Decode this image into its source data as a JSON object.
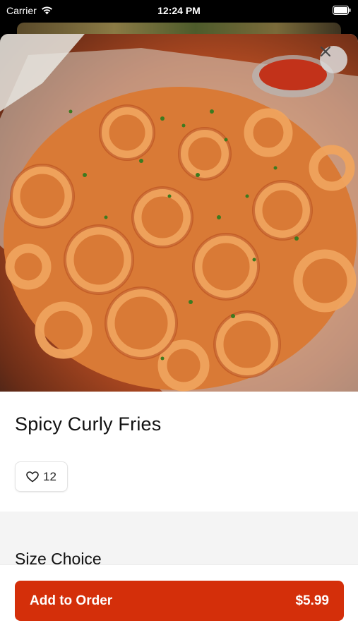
{
  "status_bar": {
    "carrier": "Carrier",
    "time": "12:24 PM"
  },
  "item": {
    "name": "Spicy Curly Fries",
    "likes": "12"
  },
  "sections": {
    "size_choice_title": "Size Choice"
  },
  "footer": {
    "add_label": "Add to Order",
    "price": "$5.99"
  },
  "colors": {
    "accent": "#d42f0a",
    "section_bg": "#f4f4f4"
  }
}
